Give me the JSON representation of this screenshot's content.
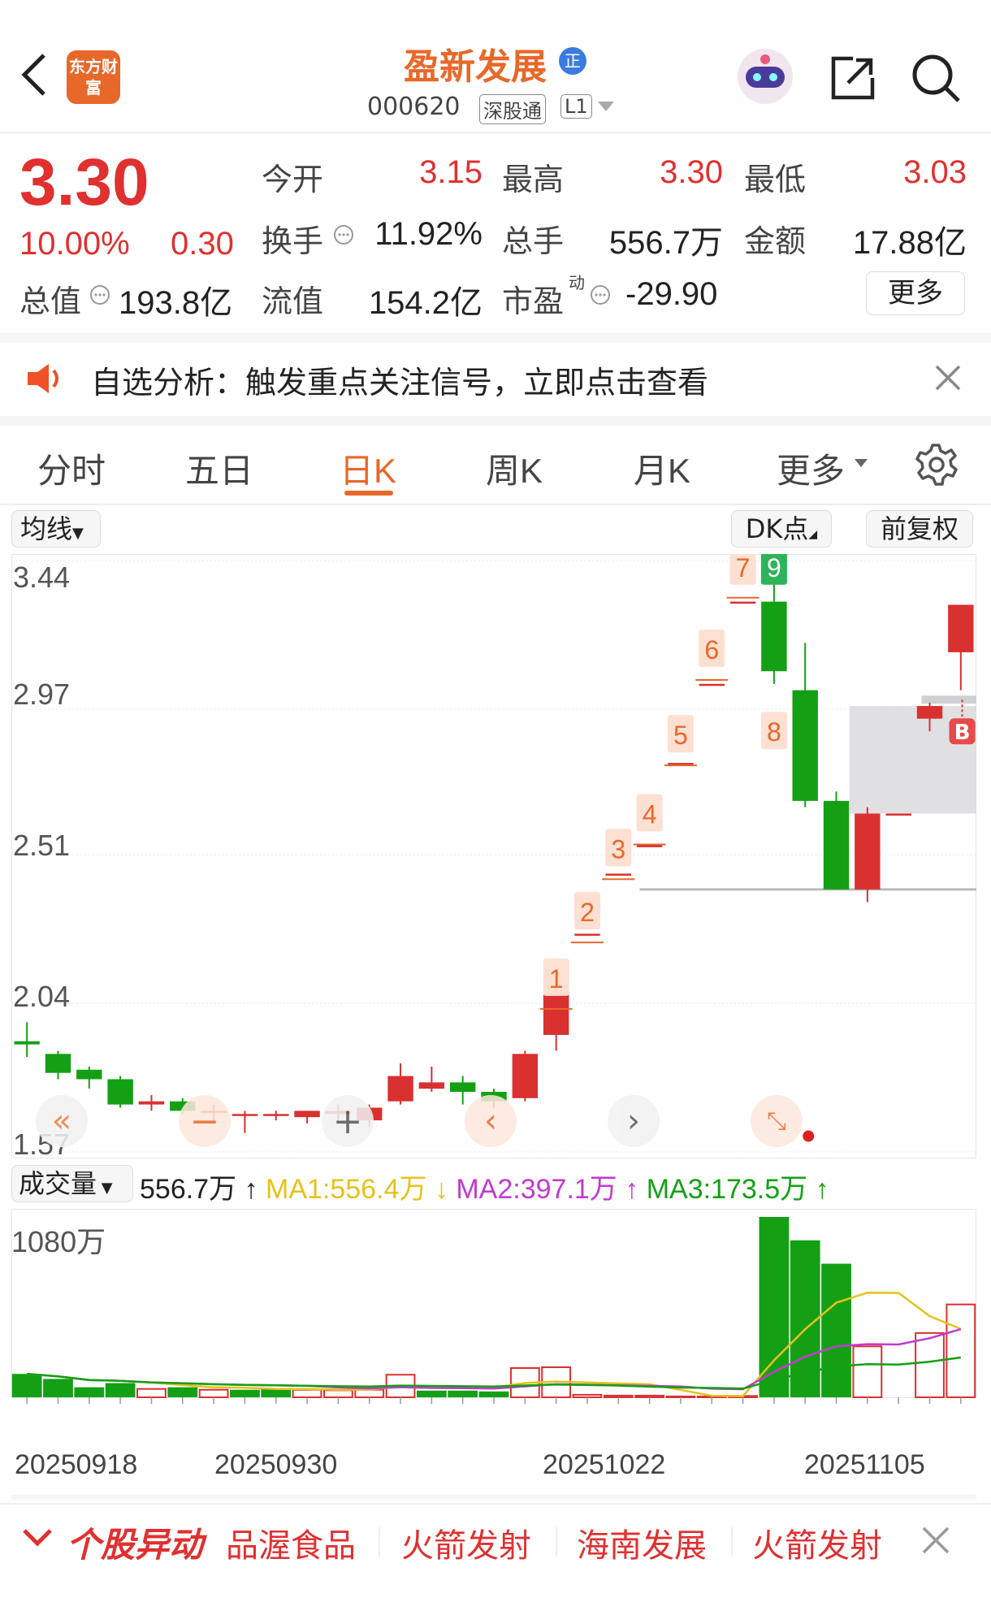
{
  "header": {
    "back_icon": "chevron-left-icon",
    "app_logo_text": "东方财富",
    "stock_name": "盈新发展",
    "badge_icon": "zheng-badge-icon",
    "stock_code": "000620",
    "tags": [
      "深股通",
      "L1"
    ],
    "robot_icon": "ai-robot-icon",
    "share_icon": "share-icon",
    "search_icon": "search-icon"
  },
  "quote": {
    "price": "3.30",
    "change_pct": "10.00%",
    "change_amt": "0.30",
    "fields": {
      "open_label": "今开",
      "open": "3.15",
      "high_label": "最高",
      "high": "3.30",
      "low_label": "最低",
      "low": "3.03",
      "turnover_label": "换手",
      "turnover": "11.92%",
      "volume_label": "总手",
      "volume": "556.7万",
      "amount_label": "金额",
      "amount": "17.88亿",
      "mktcap_label": "总值",
      "mktcap": "193.8亿",
      "float_label": "流值",
      "float_cap": "154.2亿",
      "pe_label": "市盈",
      "pe_sup": "动",
      "pe": "-29.90"
    },
    "more_button": "更多"
  },
  "notice": {
    "text": "自选分析：触发重点关注信号，立即点击查看"
  },
  "tabs": [
    {
      "label": "分时",
      "active": false
    },
    {
      "label": "五日",
      "active": false
    },
    {
      "label": "日K",
      "active": true
    },
    {
      "label": "周K",
      "active": false
    },
    {
      "label": "月K",
      "active": false
    },
    {
      "label": "更多",
      "active": false
    }
  ],
  "chart_toolbar": {
    "ma_select": "均线",
    "dk_button": "DK点",
    "adjust_button": "前复权"
  },
  "colors": {
    "up": "#d93030",
    "down": "#14a014",
    "accent": "#e8682a",
    "ma1": "#e6c21a",
    "ma2": "#c23ad0",
    "ma3": "#14a014"
  },
  "chart_data": [
    {
      "type": "candlestick",
      "y_ticks": [
        "3.44",
        "2.97",
        "2.51",
        "2.04",
        "1.57"
      ],
      "ylim": [
        1.57,
        3.44
      ],
      "candles": [
        {
          "o": 1.92,
          "c": 1.91,
          "h": 1.98,
          "l": 1.87
        },
        {
          "o": 1.88,
          "c": 1.82,
          "h": 1.89,
          "l": 1.8
        },
        {
          "o": 1.83,
          "c": 1.8,
          "h": 1.84,
          "l": 1.77
        },
        {
          "o": 1.8,
          "c": 1.72,
          "h": 1.81,
          "l": 1.71
        },
        {
          "o": 1.72,
          "c": 1.73,
          "h": 1.75,
          "l": 1.7
        },
        {
          "o": 1.73,
          "c": 1.7,
          "h": 1.74,
          "l": 1.69
        },
        {
          "o": 1.7,
          "c": 1.7,
          "h": 1.72,
          "l": 1.67
        },
        {
          "o": 1.69,
          "c": 1.69,
          "h": 1.7,
          "l": 1.63
        },
        {
          "o": 1.69,
          "c": 1.69,
          "h": 1.7,
          "l": 1.67
        },
        {
          "o": 1.68,
          "c": 1.7,
          "h": 1.7,
          "l": 1.66
        },
        {
          "o": 1.69,
          "c": 1.7,
          "h": 1.72,
          "l": 1.67
        },
        {
          "o": 1.67,
          "c": 1.71,
          "h": 1.72,
          "l": 1.65
        },
        {
          "o": 1.73,
          "c": 1.81,
          "h": 1.85,
          "l": 1.72
        },
        {
          "o": 1.77,
          "c": 1.79,
          "h": 1.84,
          "l": 1.76
        },
        {
          "o": 1.79,
          "c": 1.76,
          "h": 1.81,
          "l": 1.72
        },
        {
          "o": 1.76,
          "c": 1.73,
          "h": 1.77,
          "l": 1.71
        },
        {
          "o": 1.74,
          "c": 1.88,
          "h": 1.89,
          "l": 1.73
        },
        {
          "o": 1.94,
          "c": 2.07,
          "h": 2.07,
          "l": 1.89
        },
        {
          "o": 2.26,
          "c": 2.26,
          "h": 2.26,
          "l": 2.26
        },
        {
          "o": 2.45,
          "c": 2.45,
          "h": 2.45,
          "l": 2.45
        },
        {
          "o": 2.54,
          "c": 2.54,
          "h": 2.54,
          "l": 2.54
        },
        {
          "o": 2.8,
          "c": 2.8,
          "h": 2.8,
          "l": 2.8
        },
        {
          "o": 3.05,
          "c": 3.05,
          "h": 3.05,
          "l": 3.05
        },
        {
          "o": 3.31,
          "c": 3.31,
          "h": 3.31,
          "l": 3.31
        },
        {
          "o": 3.31,
          "c": 3.09,
          "h": 3.44,
          "l": 3.05
        },
        {
          "o": 3.03,
          "c": 2.68,
          "h": 3.18,
          "l": 2.66
        },
        {
          "o": 2.68,
          "c": 2.4,
          "h": 2.71,
          "l": 2.4
        },
        {
          "o": 2.4,
          "c": 2.64,
          "h": 2.66,
          "l": 2.36
        },
        {
          "o": 2.64,
          "c": 2.64,
          "h": 2.64,
          "l": 2.64
        },
        {
          "o": 2.94,
          "c": 2.98,
          "h": 2.99,
          "l": 2.9
        },
        {
          "o": 3.15,
          "c": 3.3,
          "h": 3.3,
          "l": 3.03
        }
      ],
      "count_labels": [
        {
          "i": 17,
          "text": "1"
        },
        {
          "i": 18,
          "text": "2"
        },
        {
          "i": 19,
          "text": "3"
        },
        {
          "i": 20,
          "text": "4"
        },
        {
          "i": 21,
          "text": "5"
        },
        {
          "i": 22,
          "text": "6"
        },
        {
          "i": 23,
          "text": "7"
        },
        {
          "i": 24,
          "text": "9"
        },
        {
          "i": 24,
          "text": "8"
        }
      ],
      "signal_label": "B",
      "x_ticks": [
        "20250918",
        "20250930",
        "20251022",
        "20251105"
      ]
    },
    {
      "type": "bar",
      "title": "成交量",
      "y_ticks": [
        "1080万"
      ],
      "ylim": [
        0,
        1080
      ],
      "legend": {
        "total": "556.7万",
        "ma1": "MA1:556.4万",
        "ma2": "MA2:397.1万",
        "ma3": "MA3:173.5万"
      },
      "values": [
        140,
        110,
        60,
        85,
        50,
        60,
        45,
        45,
        50,
        45,
        42,
        45,
        135,
        40,
        40,
        35,
        175,
        180,
        15,
        10,
        10,
        5,
        5,
        8,
        1080,
        940,
        800,
        305,
        0,
        385,
        556
      ],
      "up": [
        false,
        false,
        false,
        false,
        true,
        false,
        true,
        false,
        false,
        true,
        true,
        true,
        true,
        false,
        false,
        false,
        true,
        true,
        true,
        true,
        true,
        true,
        true,
        true,
        false,
        false,
        false,
        true,
        true,
        true,
        true
      ]
    }
  ],
  "bottom_bar": {
    "title": "个股异动",
    "items": [
      "品渥食品",
      "火箭发射",
      "海南发展",
      "火箭发射"
    ]
  }
}
